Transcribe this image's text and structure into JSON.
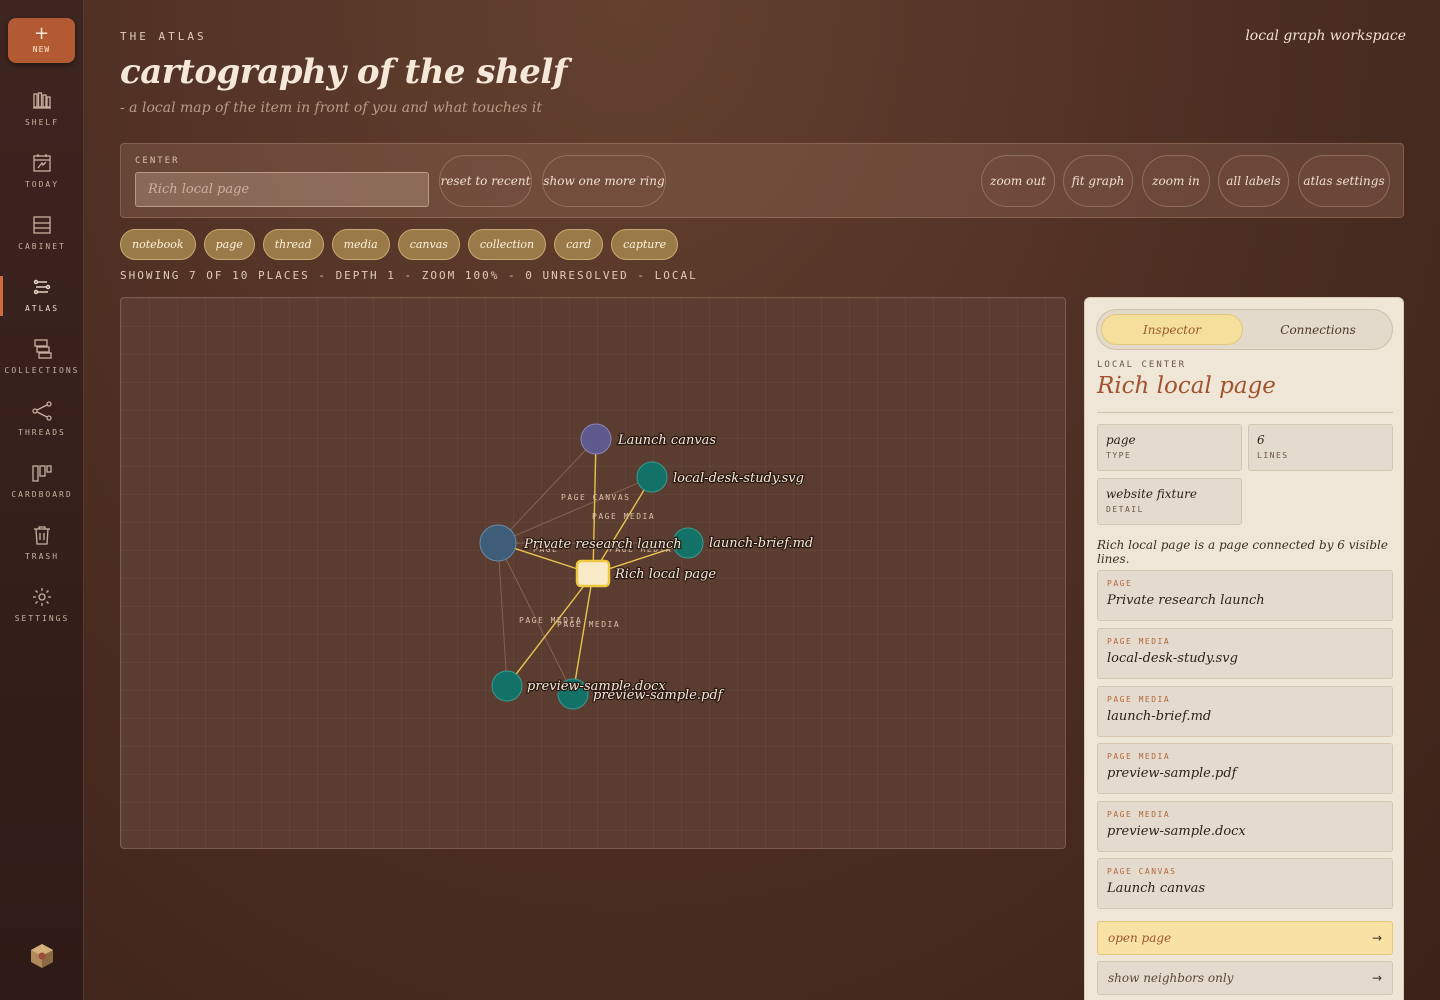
{
  "rail": {
    "new_label": "NEW",
    "items": [
      {
        "label": "SHELF",
        "icon": "shelf-icon"
      },
      {
        "label": "TODAY",
        "icon": "calendar-icon"
      },
      {
        "label": "CABINET",
        "icon": "cabinet-icon"
      },
      {
        "label": "ATLAS",
        "icon": "atlas-icon",
        "active": true
      },
      {
        "label": "COLLECTIONS",
        "icon": "collections-icon"
      },
      {
        "label": "THREADS",
        "icon": "threads-icon"
      },
      {
        "label": "CARDBOARD",
        "icon": "cardboard-icon"
      },
      {
        "label": "TRASH",
        "icon": "trash-icon"
      },
      {
        "label": "SETTINGS",
        "icon": "gear-icon"
      }
    ]
  },
  "header": {
    "kicker": "THE ATLAS",
    "title": "cartography of the shelf",
    "subtitle": "- a local map of the item in front of you and what touches it",
    "corner": "local graph workspace"
  },
  "toolbar": {
    "center_label": "CENTER",
    "center_placeholder": "Rich local page",
    "reset": "reset to recent",
    "more_ring": "show one more ring",
    "zoom_out": "zoom out",
    "fit": "fit graph",
    "zoom_in": "zoom in",
    "labels": "all labels",
    "settings": "atlas settings"
  },
  "filters": [
    "notebook",
    "page",
    "thread",
    "media",
    "canvas",
    "collection",
    "card",
    "capture"
  ],
  "status": "SHOWING 7 OF 10 PLACES - DEPTH 1 - ZOOM 100% - 0 UNRESOLVED - LOCAL",
  "graph": {
    "nodes": {
      "center": "Rich local page",
      "private": "Private research launch",
      "canvas": "Launch canvas",
      "svg": "local-desk-study.svg",
      "md": "launch-brief.md",
      "docx": "preview-sample.docx",
      "pdf": "preview-sample.pdf"
    },
    "edge_labels": {
      "page": "PAGE",
      "page_canvas": "PAGE CANVAS",
      "page_media": "PAGE MEDIA"
    },
    "colors": {
      "center": "#f8ecc8",
      "page": "#3d5d78",
      "canvas": "#5e5a8e",
      "media": "#127268",
      "edge_active": "#e8c450"
    }
  },
  "inspector": {
    "tab_inspector": "Inspector",
    "tab_connections": "Connections",
    "local_center_label": "LOCAL CENTER",
    "title": "Rich local page",
    "type_value": "page",
    "type_label": "TYPE",
    "lines_value": "6",
    "lines_label": "LINES",
    "detail_value": "website fixture",
    "detail_label": "DETAIL",
    "description": "Rich local page is a page connected by 6 visible lines.",
    "connections": [
      {
        "kind": "PAGE",
        "name": "Private research launch"
      },
      {
        "kind": "PAGE MEDIA",
        "name": "local-desk-study.svg"
      },
      {
        "kind": "PAGE MEDIA",
        "name": "launch-brief.md"
      },
      {
        "kind": "PAGE MEDIA",
        "name": "preview-sample.pdf"
      },
      {
        "kind": "PAGE MEDIA",
        "name": "preview-sample.docx"
      },
      {
        "kind": "PAGE CANVAS",
        "name": "Launch canvas"
      }
    ],
    "open_page": "open page",
    "neighbors_only": "show neighbors only",
    "arrow": "→"
  }
}
